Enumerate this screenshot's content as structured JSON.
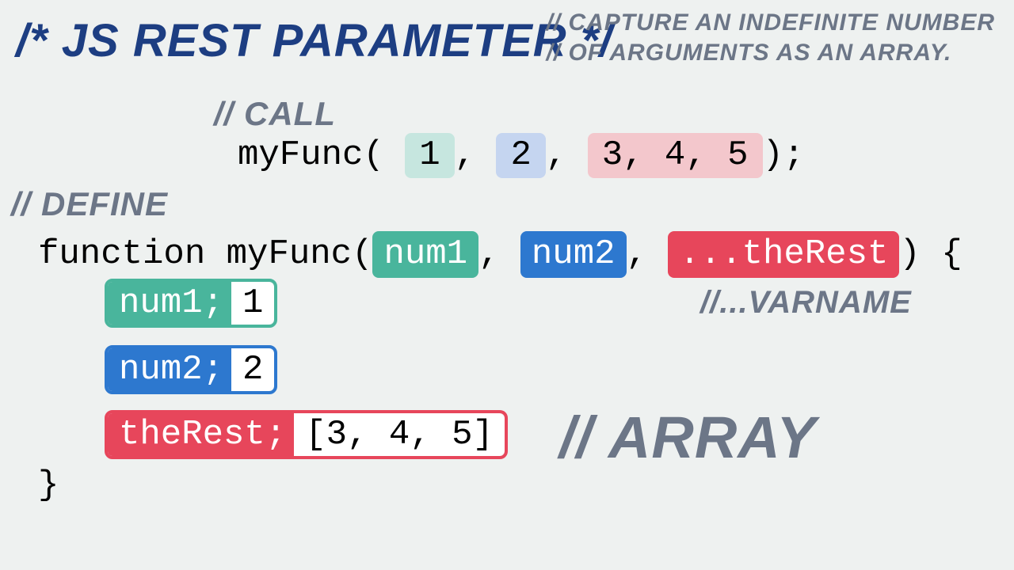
{
  "title": "/* JS REST PARAMETER */",
  "subtitle_line1": "// CAPTURE AN INDEFINITE NUMBER",
  "subtitle_line2": "// OF ARGUMENTS AS AN ARRAY.",
  "comments": {
    "call": "// CALL",
    "define": "// DEFINE",
    "varname": "//...VARNAME",
    "array": "// ARRAY"
  },
  "call": {
    "func": "myFunc(",
    "arg1": "1",
    "sep1": ", ",
    "arg2": "2",
    "sep2": ", ",
    "rest": "3, 4, 5",
    "close": ");"
  },
  "def": {
    "kw": "function myFunc(",
    "p1": "num1",
    "c1": ", ",
    "p2": "num2",
    "c2": ", ",
    "p3": "...theRest",
    "close": ") {"
  },
  "vals": {
    "num1_label": "num1;",
    "num1_val": "1",
    "num2_label": "num2;",
    "num2_val": "2",
    "rest_label": "theRest;",
    "rest_val": "[3, 4, 5]"
  },
  "close_brace": "}"
}
